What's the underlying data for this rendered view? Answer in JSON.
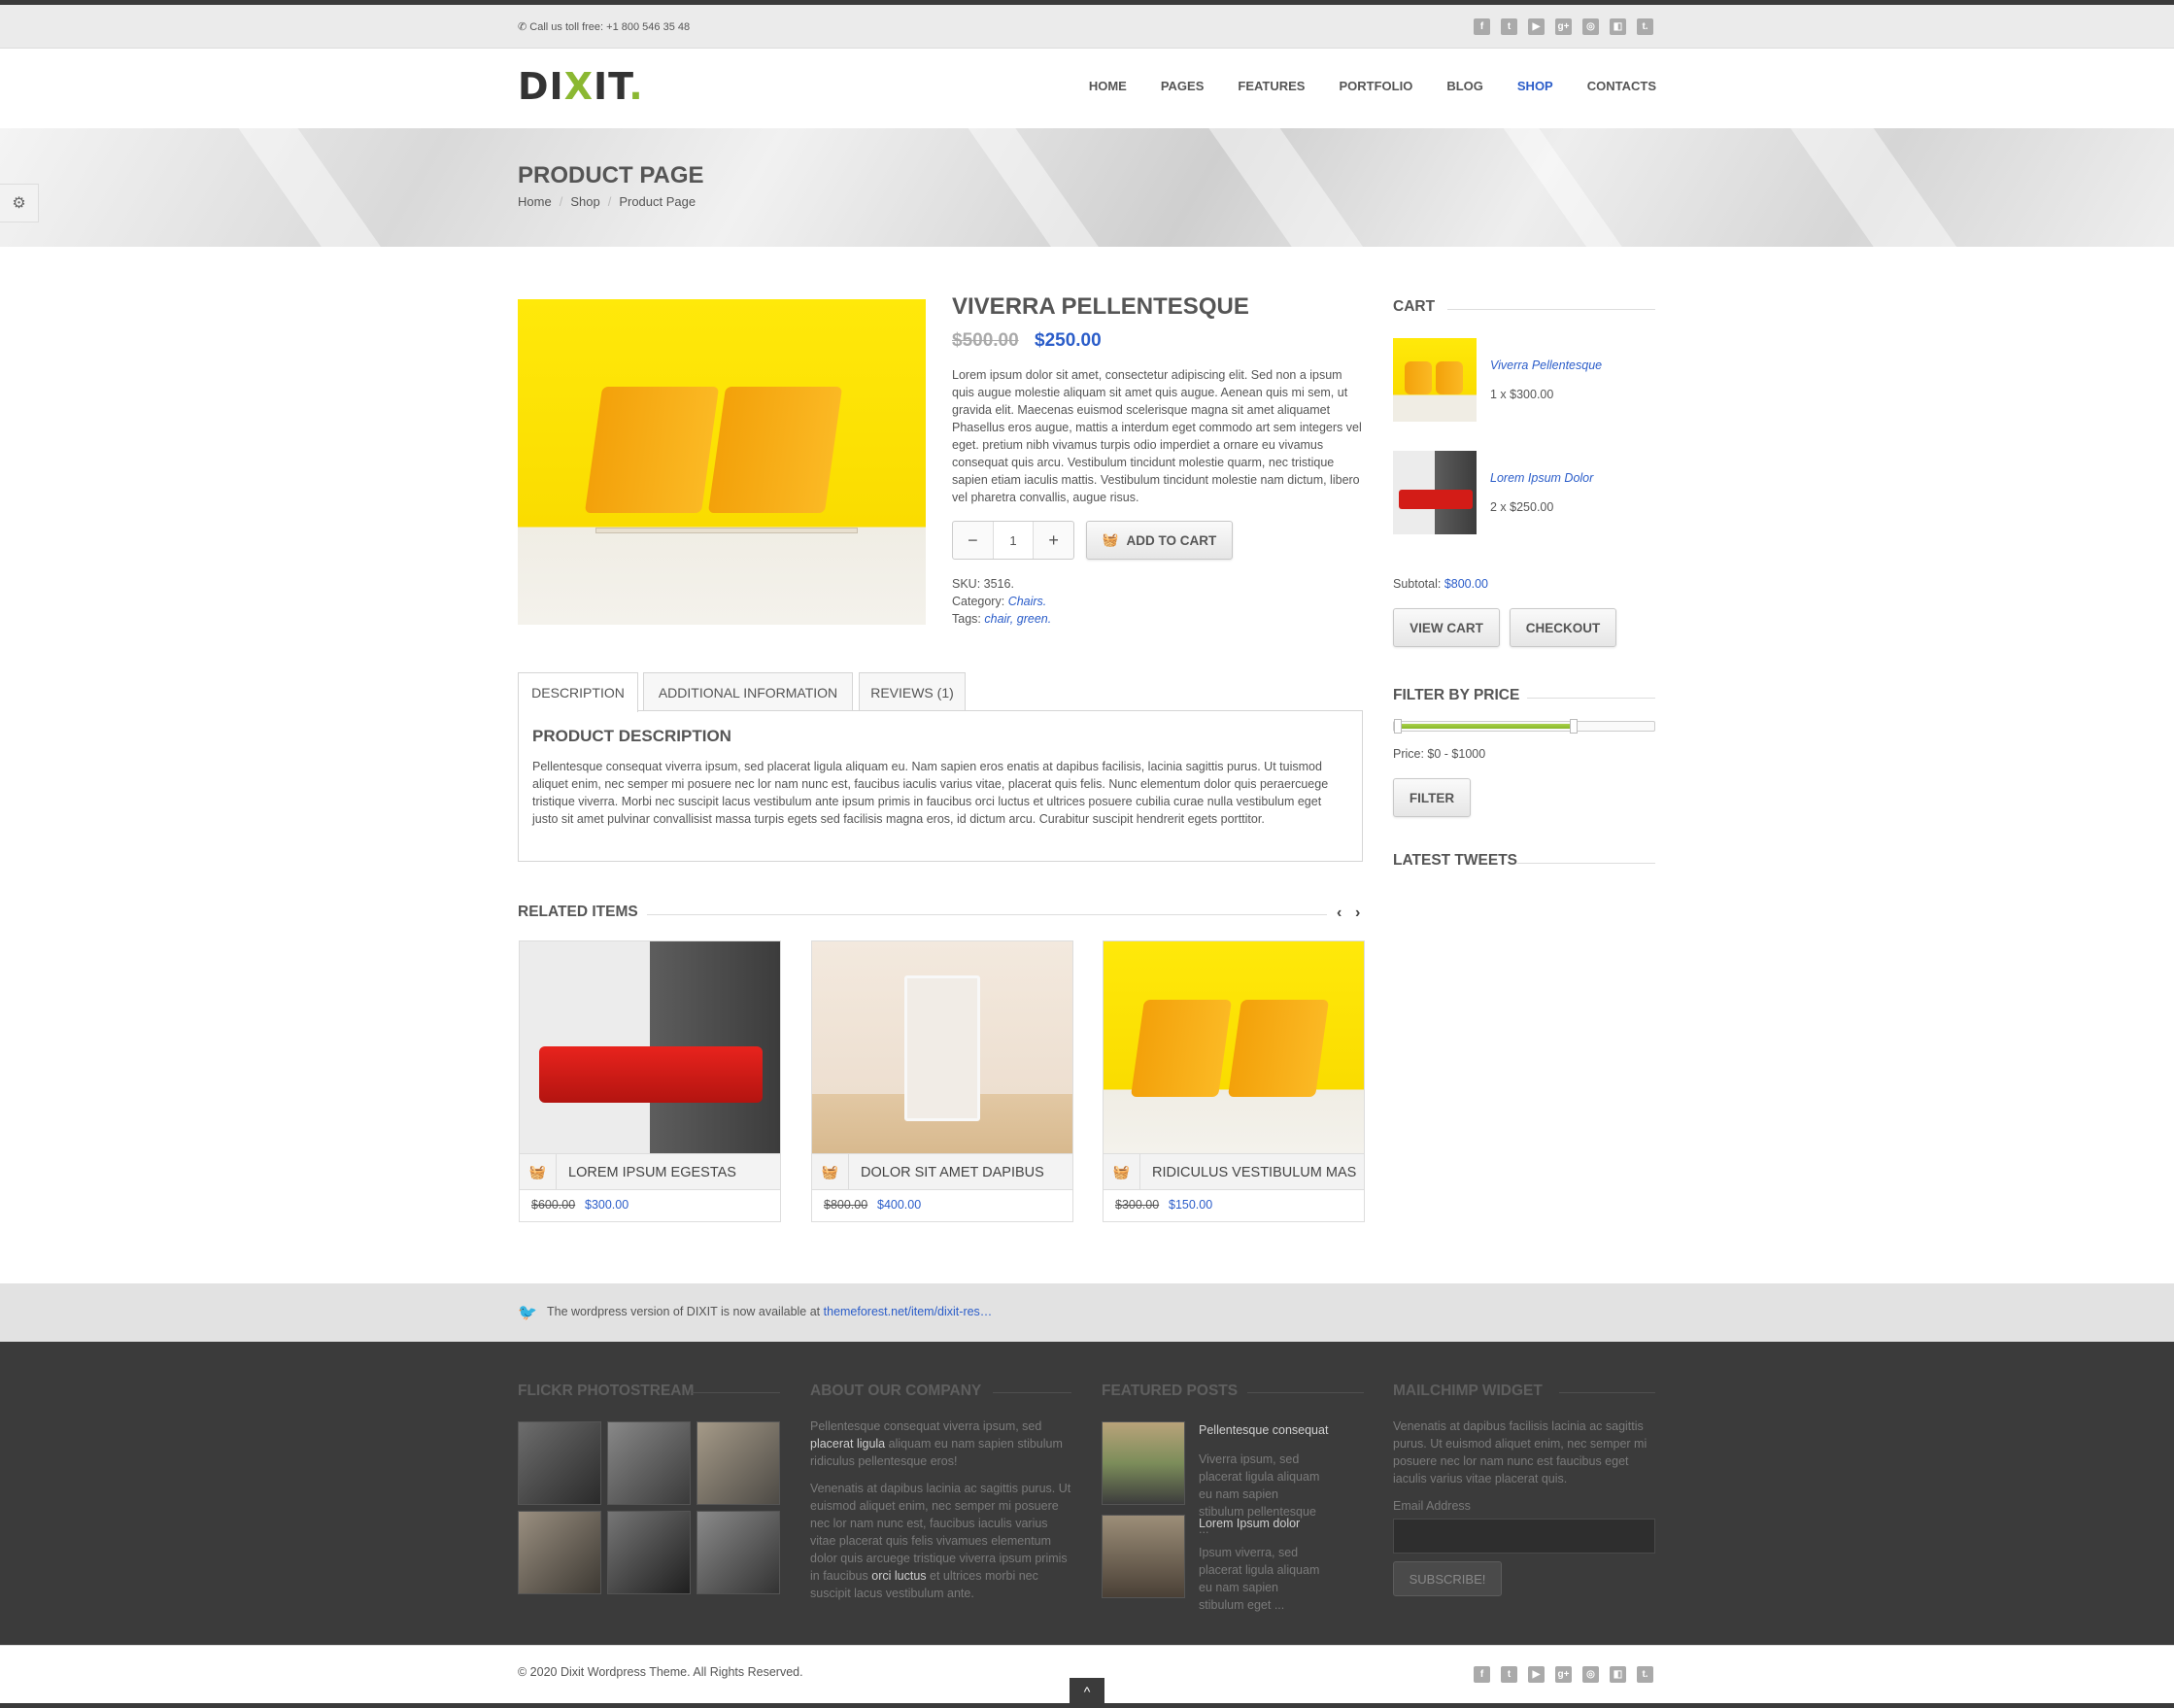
{
  "topbar": {
    "phone_label": "Call us toll free:",
    "phone_number": "+1 800 546 35 48",
    "social_icons": [
      "facebook-icon",
      "twitter-icon",
      "youtube-icon",
      "googleplus-icon",
      "dribbble-icon",
      "delicious-icon",
      "tumblr-icon"
    ]
  },
  "header": {
    "logo_text_a": "DI",
    "logo_text_x": "X",
    "logo_text_b": "IT",
    "logo_dot": ".",
    "nav": [
      "HOME",
      "PAGES",
      "FEATURES",
      "PORTFOLIO",
      "BLOG",
      "SHOP",
      "CONTACTS"
    ],
    "active_nav": "SHOP"
  },
  "title_band": {
    "title": "PRODUCT PAGE",
    "breadcrumb": [
      "Home",
      "Shop",
      "Product Page"
    ]
  },
  "product": {
    "name": "VIVERRA PELLENTESQUE",
    "price_old": "$500.00",
    "price_new": "$250.00",
    "description": "Lorem ipsum dolor sit amet, consectetur adipiscing elit. Sed non a ipsum quis augue molestie aliquam sit amet quis augue. Aenean quis mi sem, ut gravida elit. Maecenas euismod scelerisque magna sit amet aliquamet Phasellus eros augue, mattis a interdum eget commodo art sem integers vel eget. pretium nibh vivamus turpis odio imperdiet a ornare eu vivamus consequat quis arcu. Vestibulum tincidunt molestie quarm, nec tristique sapien etiam iaculis mattis. Vestibulum tincidunt molestie nam dictum, libero vel pharetra convallis, augue risus.",
    "qty_minus": "−",
    "qty_value": "1",
    "qty_plus": "+",
    "add_to_cart": "ADD TO CART",
    "sku_label": "SKU: 3516.",
    "category_label": "Category:",
    "category_value": "Chairs.",
    "tags_label": "Tags:",
    "tag_1": "chair,",
    "tag_2": "green."
  },
  "tabs": {
    "items": [
      "DESCRIPTION",
      "ADDITIONAL INFORMATION",
      "REVIEWS (1)"
    ],
    "active": "DESCRIPTION",
    "panel_title": "PRODUCT DESCRIPTION",
    "panel_text": "Pellentesque consequat viverra ipsum, sed placerat ligula aliquam eu. Nam sapien eros enatis at dapibus facilisis, lacinia sagittis purus. Ut tuismod aliquet enim, nec semper mi posuere nec lor nam nunc est, faucibus iaculis varius vitae, placerat quis felis. Nunc elementum dolor quis peraercuege tristique viverra. Morbi nec suscipit lacus vestibulum ante ipsum primis in faucibus orci luctus et ultrices posuere cubilia curae nulla vestibulum eget justo sit amet pulvinar convallisist massa turpis egets sed facilisis magna eros, id dictum arcu. Curabitur suscipit hendrerit egets porttitor."
  },
  "related": {
    "title": "RELATED ITEMS",
    "prev": "‹",
    "next": "›",
    "items": [
      {
        "title": "LOREM IPSUM EGESTAS",
        "old": "$600.00",
        "new": "$300.00"
      },
      {
        "title": "DOLOR SIT AMET DAPIBUS",
        "old": "$800.00",
        "new": "$400.00"
      },
      {
        "title": "RIDICULUS VESTIBULUM MAS",
        "old": "$300.00",
        "new": "$150.00"
      }
    ]
  },
  "sidebar": {
    "cart_title": "CART",
    "cart_items": [
      {
        "name": "Viverra Pellentesque",
        "qty": "1 x $300.00"
      },
      {
        "name": "Lorem Ipsum Dolor",
        "qty": "2 x $250.00"
      }
    ],
    "subtotal_label": "Subtotal:",
    "subtotal_value": "$800.00",
    "view_cart": "VIEW CART",
    "checkout": "CHECKOUT",
    "filter_title": "FILTER BY PRICE",
    "price_range_label": "Price: $0 - $1000",
    "slider_min_fraction": 0.0,
    "slider_max_fraction": 0.69,
    "filter_button": "FILTER",
    "tweets_title": "LATEST TWEETS"
  },
  "tweetbar": {
    "text": "The wordpress version of DIXIT is now available at",
    "link": "themeforest.net/item/dixit-res…"
  },
  "footer": {
    "flickr_title": "FLICKR PHOTOSTREAM",
    "about_title": "ABOUT OUR COMPANY",
    "about_p1_a": "Pellentesque consequat viverra ipsum, sed",
    "about_p1_hl": "placerat ligula",
    "about_p1_b": "aliquam eu nam sapien stibulum ridiculus pellentesque eros!",
    "about_p2_a": "Venenatis at dapibus lacinia ac sagittis purus. Ut euismod aliquet enim, nec semper mi posuere nec lor nam nunc est, faucibus iaculis varius vitae placerat quis felis vivamues elementum dolor quis arcuege tristique viverra ipsum primis in faucibus",
    "about_p2_hl": "orci luctus",
    "about_p2_b": "et ultrices morbi nec suscipit lacus vestibulum ante.",
    "featured_title": "FEATURED POSTS",
    "posts": [
      {
        "title": "Pellentesque consequat",
        "text": "Viverra ipsum, sed placerat ligula aliquam eu nam sapien stibulum pellentesque ..."
      },
      {
        "title": "Lorem Ipsum dolor",
        "text": "Ipsum viverra, sed placerat ligula aliquam eu nam sapien stibulum eget ..."
      }
    ],
    "mailchimp_title": "MAILCHIMP WIDGET",
    "mailchimp_text": "Venenatis at dapibus facilisis lacinia ac sagittis purus. Ut euismod aliquet enim, nec semper mi posuere nec lor nam nunc est faucibus eget iaculis varius vitae placerat quis.",
    "email_label": "Email Address",
    "subscribe": "SUBSCRIBE!"
  },
  "bottombar": {
    "copyright": "© 2020 Dixit Wordpress Theme. All Rights Reserved.",
    "to_top": "^"
  }
}
